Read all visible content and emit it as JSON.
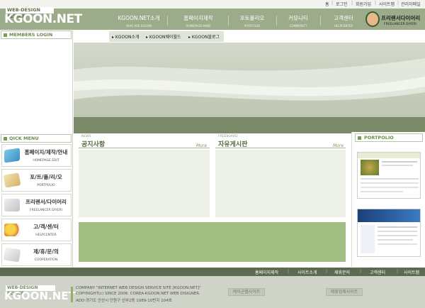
{
  "header": {
    "utility_links": [
      "홈",
      "로그인",
      "회원가입",
      "사이트맵",
      "관리자메일"
    ],
    "logo_small": "WEB-DESIGN SEVICE",
    "logo_big": "KGOON.NET",
    "nav": [
      {
        "title": "KGOON.NET소개",
        "sub": "WHO ARE KGOON"
      },
      {
        "title": "홈페이지제작",
        "sub": "HOMEPAGE MAKE"
      },
      {
        "title": "포토폴리오",
        "sub": "PORTFOLIO"
      },
      {
        "title": "커뮤니티",
        "sub": "COMMUNITY"
      },
      {
        "title": "고객센터",
        "sub": "HELPCENTER"
      }
    ],
    "freelancer": {
      "title": "프리랜서다이어리",
      "sub": "FREELANCER DIYERI"
    }
  },
  "left": {
    "members_login": "MEMBERS LOGIN",
    "quick_menu": "QICK MENU",
    "quick_items": [
      {
        "title": "홈페이지/제작/안내",
        "sub": "HOMEPAGE EDIT"
      },
      {
        "title": "포/트/폴/리/오",
        "sub": "PORTPOLIO"
      },
      {
        "title": "프리랜서/다이어리",
        "sub": "FREELANCER DIYERI"
      },
      {
        "title": "고/객/센/터",
        "sub": "HELPCENTER"
      },
      {
        "title": "제/휴/문/의",
        "sub": "COOPERATION"
      }
    ]
  },
  "subnav": [
    "KGOON소개",
    "KGOON웨이월드",
    "KGOON블로그"
  ],
  "boards": {
    "news": {
      "label": "NEWS",
      "title": "공지사항",
      "more": "More"
    },
    "freeboard": {
      "label": "FREEBOARD",
      "title": "자유게시판",
      "more": "More"
    }
  },
  "portfolio": {
    "title": "PORTPOLIO"
  },
  "footer": {
    "links": [
      "홈페이지제작",
      "사이트소개",
      "제휴문의",
      "고객센터",
      "사이트맵"
    ],
    "logo_small": "WEB-DESIGN SEVICE",
    "logo_big": "KGOON.NET",
    "info_line1": "COMPANY \"INTERNET WEB DESIGN SERVICE SITE [KGOON.NET]\"",
    "info_line2": "COPYRIGHT(c) SINCE 2006. COREA-KGOON.NET WEB DISIGNER.",
    "info_line3": "ADD:경기도 안산시 단원구 선부2동 1089-10번지 104호",
    "button_left": "케이군웹사이트",
    "button_right": "제휴업체사이트"
  },
  "colors": {
    "header_green": "#9cab8a",
    "accent_green": "#7d9a5c",
    "footer_dark": "#5c6a50"
  }
}
